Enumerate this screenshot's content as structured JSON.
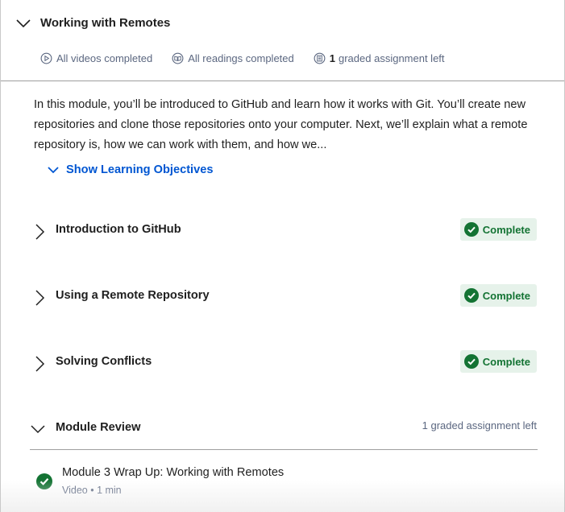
{
  "module": {
    "title": "Working with Remotes",
    "stats": {
      "videos": "All videos completed",
      "readings": "All readings completed",
      "graded_count": "1",
      "graded_text": "graded assignment left"
    },
    "description": "In this module, you’ll be introduced to GitHub and learn how it works with Git. You’ll create new repositories and clone those repositories onto your computer. Next, we’ll explain what a remote repository is, how we can work with them, and how we...",
    "objectives_label": "Show Learning Objectives"
  },
  "lessons": [
    {
      "name": "Introduction to GitHub",
      "status": "Complete"
    },
    {
      "name": "Using a Remote Repository",
      "status": "Complete"
    },
    {
      "name": "Solving Conflicts",
      "status": "Complete"
    }
  ],
  "review": {
    "name": "Module Review",
    "assignments_left": "1 graded assignment left",
    "items": [
      {
        "title": "Module 3 Wrap Up: Working with Remotes",
        "meta": "Video • 1 min"
      }
    ]
  },
  "colors": {
    "link": "#0056d2",
    "success": "#137333",
    "success_bg": "#e6f2ea",
    "muted": "#5b6780"
  }
}
